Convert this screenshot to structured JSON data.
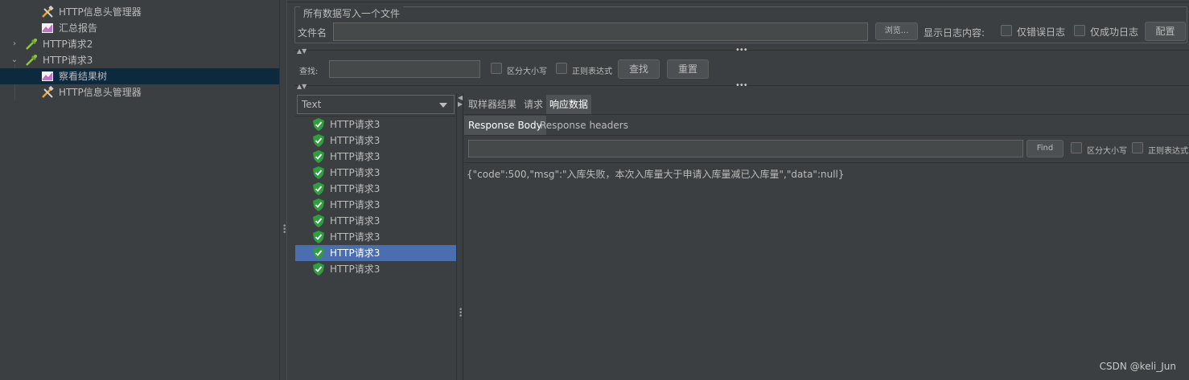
{
  "tree": {
    "items": [
      {
        "label": "HTTP信息头管理器",
        "icon": "wrench-hammer-icon",
        "indent": 2
      },
      {
        "label": "汇总报告",
        "icon": "graph-report-icon",
        "indent": 2
      },
      {
        "label": "HTTP请求2",
        "icon": "pipette-sampler-icon",
        "indent": 1,
        "arrow": "›"
      },
      {
        "label": "HTTP请求3",
        "icon": "pipette-sampler-icon",
        "indent": 1,
        "arrow": "⌄"
      },
      {
        "label": "察看结果树",
        "icon": "graph-report-icon",
        "indent": 2,
        "selected": true
      },
      {
        "label": "HTTP信息头管理器",
        "icon": "wrench-hammer-icon",
        "indent": 2
      }
    ]
  },
  "file_section": {
    "legend": "所有数据写入一个文件",
    "filename_label": "文件名",
    "filename_value": "",
    "browse_button": "浏览...",
    "log_content_label": "显示日志内容:",
    "errors_only_label": "仅错误日志",
    "success_only_label": "仅成功日志",
    "configure_button": "配置"
  },
  "search_bar": {
    "label": "查找:",
    "value": "",
    "case_sensitive_label": "区分大小写",
    "regex_label": "正则表达式",
    "search_button": "查找",
    "reset_button": "重置"
  },
  "renderer": {
    "selected": "Text"
  },
  "results": [
    {
      "label": "HTTP请求3",
      "status": "success"
    },
    {
      "label": "HTTP请求3",
      "status": "success"
    },
    {
      "label": "HTTP请求3",
      "status": "success"
    },
    {
      "label": "HTTP请求3",
      "status": "success"
    },
    {
      "label": "HTTP请求3",
      "status": "success"
    },
    {
      "label": "HTTP请求3",
      "status": "success"
    },
    {
      "label": "HTTP请求3",
      "status": "success"
    },
    {
      "label": "HTTP请求3",
      "status": "success"
    },
    {
      "label": "HTTP请求3",
      "status": "success",
      "selected": true
    },
    {
      "label": "HTTP请求3",
      "status": "success"
    }
  ],
  "detail": {
    "tabs": [
      "取样器结果",
      "请求",
      "响应数据"
    ],
    "active_tab": "响应数据",
    "subtabs": [
      "Response Body",
      "Response headers"
    ],
    "active_subtab": "Response Body",
    "find_value": "",
    "find_button": "Find",
    "case_sensitive_label": "区分大小写",
    "regex_label": "正则表达式",
    "response_body": "{\"code\":500,\"msg\":\"入库失败，本次入库量大于申请入库量减已入库量\",\"data\":null}"
  },
  "watermark": "CSDN @keli_Jun",
  "colors": {
    "background": "#3c3f41",
    "selection_tree": "#0d293e",
    "selection_list": "#4b6eaf",
    "success_shield": "#2e9e3e"
  }
}
